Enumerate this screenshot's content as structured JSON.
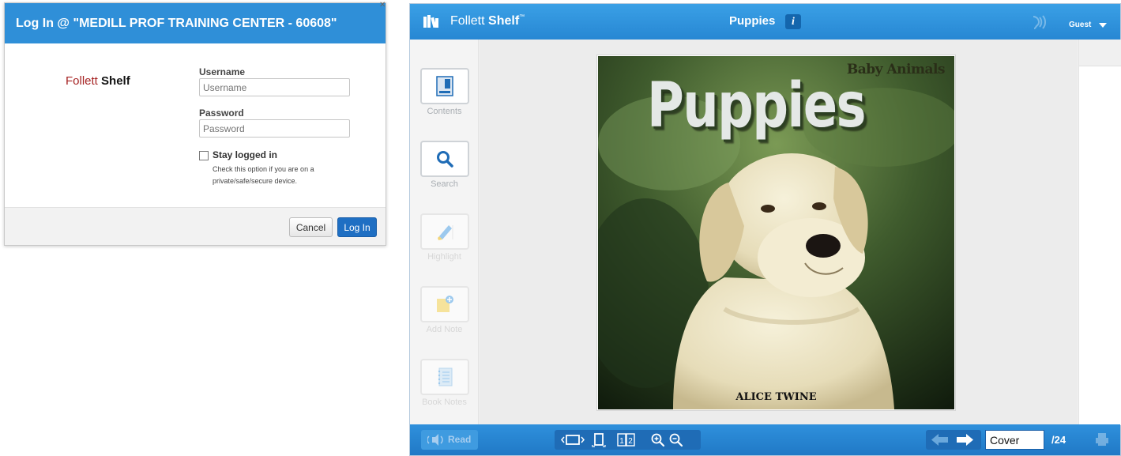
{
  "login_dialog": {
    "title": "Log In @ \"MEDILL PROF TRAINING CENTER - 60608\"",
    "logo": {
      "follett": "Follett",
      "shelf": "Shelf"
    },
    "username": {
      "label": "Username",
      "placeholder": "Username",
      "value": ""
    },
    "password": {
      "label": "Password",
      "placeholder": "Password",
      "value": ""
    },
    "stay_logged_in": {
      "label": "Stay logged in",
      "hint": "Check this option if you are on a private/safe/secure device.",
      "checked": false
    },
    "buttons": {
      "cancel": "Cancel",
      "login": "Log In"
    }
  },
  "reader": {
    "brand": {
      "follett": "Follett",
      "shelf": "Shelf",
      "tm": "™"
    },
    "book_title": "Puppies",
    "info_button": "i",
    "user_menu": "Guest",
    "sidebar": [
      {
        "label": "Contents",
        "icon": "contents-icon",
        "enabled": true
      },
      {
        "label": "Search",
        "icon": "magnifier-icon",
        "enabled": true
      },
      {
        "label": "Highlight",
        "icon": "highlighter-icon",
        "enabled": false
      },
      {
        "label": "Add Note",
        "icon": "sticky-note-add-icon",
        "enabled": false
      },
      {
        "label": "Book Notes",
        "icon": "notebook-icon",
        "enabled": false
      }
    ],
    "cover": {
      "series": "Baby Animals",
      "title": "Puppies",
      "author": "ALICE TWINE"
    },
    "bottom": {
      "read_button": "Read",
      "page_input": "Cover",
      "page_total": "/24"
    },
    "colors": {
      "bar_blue": "#2787d3",
      "dark_blue": "#1f6cb6",
      "login_blue": "#1f6fc3",
      "brand_red": "#a62424"
    }
  }
}
